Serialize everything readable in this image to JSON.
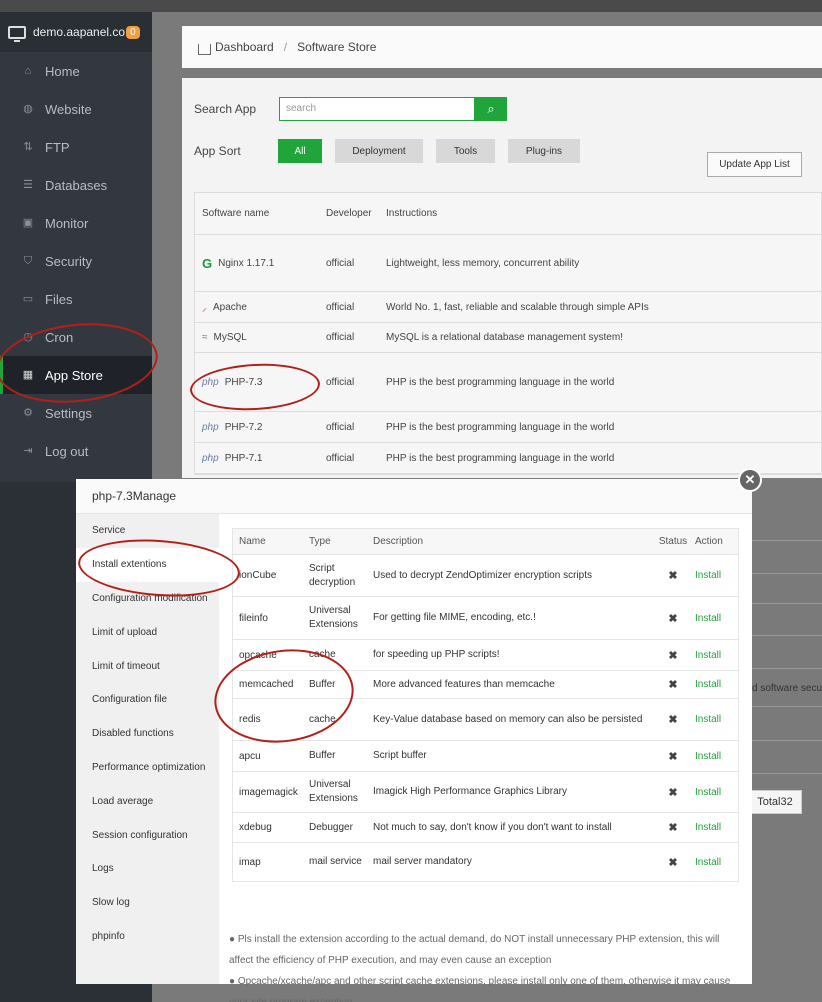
{
  "sidebar": {
    "brand": "demo.aapanel.co",
    "badge": "0",
    "items": [
      {
        "label": "Home",
        "icon": "home-icon"
      },
      {
        "label": "Website",
        "icon": "globe-icon"
      },
      {
        "label": "FTP",
        "icon": "ftp-icon"
      },
      {
        "label": "Databases",
        "icon": "database-icon"
      },
      {
        "label": "Monitor",
        "icon": "monitor-icon"
      },
      {
        "label": "Security",
        "icon": "shield-icon"
      },
      {
        "label": "Files",
        "icon": "folder-icon"
      },
      {
        "label": "Cron",
        "icon": "clock-icon"
      },
      {
        "label": "App Store",
        "icon": "grid-icon",
        "active": true
      },
      {
        "label": "Settings",
        "icon": "gear-icon"
      },
      {
        "label": "Log out",
        "icon": "logout-icon"
      }
    ]
  },
  "breadcrumb": {
    "home": "Dashboard",
    "separator": "/",
    "current": "Software Store"
  },
  "store": {
    "search_label": "Search App",
    "search_placeholder": "search",
    "sort_label": "App Sort",
    "sorts": [
      "All",
      "Deployment",
      "Tools",
      "Plug-ins"
    ],
    "update_button": "Update App List",
    "columns": [
      "Software name",
      "Developer",
      "Instructions"
    ],
    "apps": [
      {
        "logo": "G",
        "name": "Nginx 1.17.1",
        "dev": "official",
        "desc": "Lightweight, less memory, concurrent ability"
      },
      {
        "logo": "⸝",
        "name": "Apache",
        "dev": "official",
        "desc": "World No. 1, fast, reliable and scalable through simple APIs"
      },
      {
        "logo": "≈",
        "name": "MySQL",
        "dev": "official",
        "desc": "MySQL is a relational database management system!"
      },
      {
        "logo": "php",
        "name": "PHP-7.3",
        "dev": "official",
        "desc": "PHP is the best programming language in the world"
      },
      {
        "logo": "php",
        "name": "PHP-7.2",
        "dev": "official",
        "desc": "PHP is the best programming language in the world"
      },
      {
        "logo": "php",
        "name": "PHP-7.1",
        "dev": "official",
        "desc": "PHP is the best programming language in the world"
      }
    ],
    "total": "Total32",
    "peek_text": "d software secu"
  },
  "modal": {
    "title": "php-7.3Manage",
    "close": "✕",
    "menu": [
      "Service",
      "Install extentions",
      "Configuration modification",
      "Limit of upload",
      "Limit of timeout",
      "Configuration file",
      "Disabled functions",
      "Performance optimization",
      "Load average",
      "Session configuration",
      "Logs",
      "Slow log",
      "phpinfo"
    ],
    "columns": [
      "Name",
      "Type",
      "Description",
      "Status",
      "Action"
    ],
    "extensions": [
      {
        "name": "ionCube",
        "type": "Script decryption",
        "desc": "Used to decrypt ZendOptimizer encryption scripts",
        "status": "✖",
        "action": "Install"
      },
      {
        "name": "fileinfo",
        "type": "Universal Extensions",
        "desc": "For getting file MIME, encoding, etc.!",
        "status": "✖",
        "action": "Install"
      },
      {
        "name": "opcache",
        "type": "cache",
        "desc": "for speeding up PHP scripts!",
        "status": "✖",
        "action": "Install"
      },
      {
        "name": "memcached",
        "type": "Buffer",
        "desc": "More advanced features than memcache",
        "status": "✖",
        "action": "Install"
      },
      {
        "name": "redis",
        "type": "cache",
        "desc": "Key-Value database based on memory can also be persisted",
        "status": "✖",
        "action": "Install"
      },
      {
        "name": "apcu",
        "type": "Buffer",
        "desc": "Script buffer",
        "status": "✖",
        "action": "Install"
      },
      {
        "name": "imagemagick",
        "type": "Universal Extensions",
        "desc": "Imagick High Performance Graphics Library",
        "status": "✖",
        "action": "Install"
      },
      {
        "name": "xdebug",
        "type": "Debugger",
        "desc": "Not much to say, don't know if you don't want to install",
        "status": "✖",
        "action": "Install"
      },
      {
        "name": "imap",
        "type": "mail service",
        "desc": "mail server mandatory",
        "status": "✖",
        "action": "Install"
      }
    ],
    "notes": [
      "Pls install the extension according to the actual demand, do NOT install unnecessary PHP extension, this will affect the efficiency of PHP execution, and may even cause an exception",
      "Opcache/xcache/apc and other script cache extensions, please install only one of them, otherwise it may cause your site program exception"
    ]
  }
}
